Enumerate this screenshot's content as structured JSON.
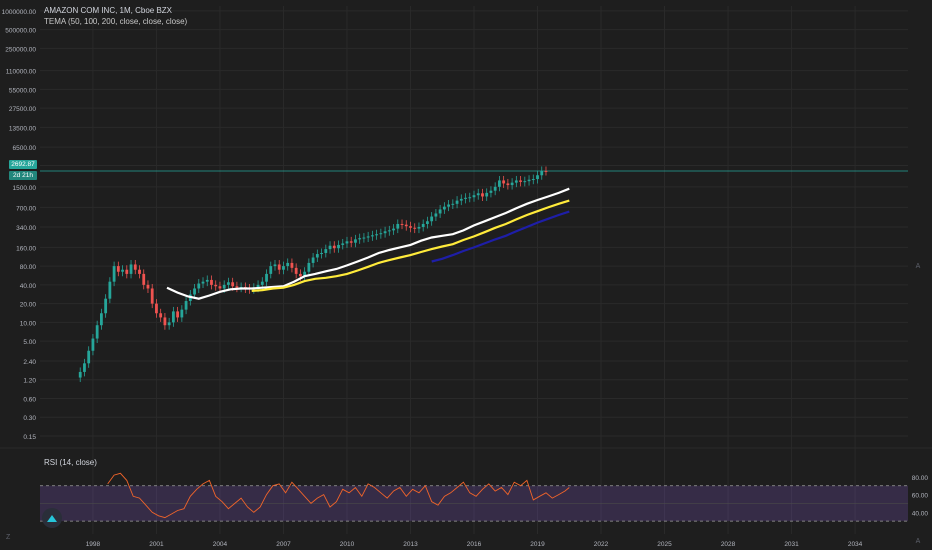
{
  "header": {
    "title": "AMAZON COM INC, 1M, Cboe BZX",
    "indicator": "TEMA (50, 100, 200, close, close, close)"
  },
  "rsi": {
    "label": "RSI (14, close)",
    "levels": [
      70,
      30
    ],
    "axis_labels": [
      "80.00",
      "60.00",
      "40.00"
    ]
  },
  "badges": {
    "last_price": "2692.87",
    "tema_value": "2d 21h"
  },
  "colors": {
    "bg": "#1e1e1e",
    "grid": "#2a2a2a",
    "up": "#26a69a",
    "down": "#ef5350",
    "tema50": "#ffffff",
    "tema100": "#ffeb3b",
    "tema200": "#1e1ea8",
    "rsi_line": "#f0642a",
    "rsi_band": "#7e57c2"
  },
  "chart_data": {
    "type": "line",
    "title": "AMAZON COM INC, 1M, Cboe BZX",
    "scale": "log",
    "price_ticks": [
      "1000000.00",
      "500000.00",
      "250000.00",
      "110000.00",
      "55000.00",
      "27500.00",
      "13500.00",
      "6500.00",
      "3300.00",
      "1500.00",
      "700.00",
      "340.00",
      "160.00",
      "80.00",
      "40.00",
      "20.00",
      "10.00",
      "5.00",
      "2.40",
      "1.20",
      "0.60",
      "0.30",
      "0.15"
    ],
    "price_ticks_values": [
      1000000,
      500000,
      250000,
      110000,
      55000,
      27500,
      13500,
      6500,
      3300,
      1500,
      700,
      340,
      160,
      80,
      40,
      20,
      10,
      5,
      2.4,
      1.2,
      0.6,
      0.3,
      0.15
    ],
    "x_ticks": [
      "1998",
      "2001",
      "2004",
      "2007",
      "2010",
      "2013",
      "2016",
      "2019",
      "2022",
      "2025",
      "2028",
      "2031",
      "2034"
    ],
    "x_ticks_values": [
      1998,
      2001,
      2004,
      2007,
      2010,
      2013,
      2016,
      2019,
      2022,
      2025,
      2028,
      2031,
      2034
    ],
    "xlim": [
      1995.5,
      2036.5
    ],
    "series": [
      {
        "name": "TEMA 50",
        "x": [
          2001.5,
          2002,
          2002.5,
          2003,
          2003.5,
          2004,
          2004.5,
          2005,
          2005.5,
          2006,
          2006.5,
          2007,
          2007.5,
          2008,
          2008.5,
          2009,
          2009.5,
          2010,
          2010.5,
          2011,
          2011.5,
          2012,
          2012.5,
          2013,
          2013.5,
          2014,
          2014.5,
          2015,
          2015.5,
          2016,
          2016.5,
          2017,
          2017.5,
          2018,
          2018.5,
          2019,
          2019.5,
          2020,
          2020.5
        ],
        "y": [
          36,
          30,
          26,
          24,
          27,
          31,
          34,
          35,
          35,
          36,
          37,
          38,
          45,
          55,
          60,
          66,
          72,
          82,
          95,
          110,
          130,
          145,
          160,
          175,
          205,
          230,
          245,
          260,
          300,
          360,
          420,
          490,
          570,
          680,
          800,
          920,
          1050,
          1200,
          1400
        ]
      },
      {
        "name": "TEMA 100",
        "x": [
          2005.5,
          2006,
          2006.5,
          2007,
          2007.5,
          2008,
          2008.5,
          2009,
          2009.5,
          2010,
          2010.5,
          2011,
          2011.5,
          2012,
          2012.5,
          2013,
          2013.5,
          2014,
          2014.5,
          2015,
          2015.5,
          2016,
          2016.5,
          2017,
          2017.5,
          2018,
          2018.5,
          2019,
          2019.5,
          2020,
          2020.5
        ],
        "y": [
          32,
          33,
          35,
          36,
          40,
          46,
          50,
          52,
          55,
          60,
          68,
          78,
          90,
          100,
          110,
          120,
          135,
          150,
          165,
          180,
          210,
          240,
          280,
          330,
          380,
          450,
          530,
          610,
          700,
          800,
          900
        ]
      },
      {
        "name": "TEMA 200",
        "x": [
          2014,
          2014.5,
          2015,
          2015.5,
          2016,
          2016.5,
          2017,
          2017.5,
          2018,
          2018.5,
          2019,
          2019.5,
          2020,
          2020.5
        ],
        "y": [
          95,
          105,
          120,
          140,
          160,
          185,
          215,
          245,
          290,
          340,
          400,
          460,
          530,
          600
        ]
      }
    ],
    "candles": {
      "x": [
        1997.4,
        1997.6,
        1997.8,
        1998.0,
        1998.2,
        1998.4,
        1998.6,
        1998.8,
        1999.0,
        1999.2,
        1999.4,
        1999.6,
        1999.8,
        2000.0,
        2000.2,
        2000.4,
        2000.6,
        2000.8,
        2001.0,
        2001.2,
        2001.4,
        2001.6,
        2001.8,
        2002.0,
        2002.2,
        2002.4,
        2002.6,
        2002.8,
        2003.0,
        2003.2,
        2003.4,
        2003.6,
        2003.8,
        2004.0,
        2004.2,
        2004.4,
        2004.6,
        2004.8,
        2005.0,
        2005.2,
        2005.4,
        2005.6,
        2005.8,
        2006.0,
        2006.2,
        2006.4,
        2006.6,
        2006.8,
        2007.0,
        2007.2,
        2007.4,
        2007.6,
        2007.8,
        2008.0,
        2008.2,
        2008.4,
        2008.6,
        2008.8,
        2009.0,
        2009.2,
        2009.4,
        2009.6,
        2009.8,
        2010.0,
        2010.2,
        2010.4,
        2010.6,
        2010.8,
        2011.0,
        2011.2,
        2011.4,
        2011.6,
        2011.8,
        2012.0,
        2012.2,
        2012.4,
        2012.6,
        2012.8,
        2013.0,
        2013.2,
        2013.4,
        2013.6,
        2013.8,
        2014.0,
        2014.2,
        2014.4,
        2014.6,
        2014.8,
        2015.0,
        2015.2,
        2015.4,
        2015.6,
        2015.8,
        2016.0,
        2016.2,
        2016.4,
        2016.6,
        2016.8,
        2017.0,
        2017.2,
        2017.4,
        2017.6,
        2017.8,
        2018.0,
        2018.2,
        2018.4,
        2018.6,
        2018.8,
        2019.0,
        2019.2,
        2019.4,
        2019.6,
        2019.8,
        2020.0,
        2020.2,
        2020.4
      ],
      "close": [
        1.6,
        2.2,
        3.5,
        5.5,
        9,
        14,
        24,
        45,
        80,
        65,
        70,
        60,
        85,
        70,
        60,
        40,
        35,
        20,
        14,
        12,
        9,
        10,
        15,
        12,
        16,
        22,
        28,
        35,
        42,
        45,
        48,
        40,
        38,
        35,
        40,
        44,
        38,
        36,
        37,
        35,
        34,
        36,
        40,
        45,
        60,
        80,
        85,
        70,
        80,
        90,
        75,
        60,
        55,
        65,
        90,
        110,
        125,
        130,
        150,
        170,
        155,
        175,
        185,
        200,
        190,
        215,
        225,
        230,
        240,
        250,
        260,
        270,
        290,
        300,
        320,
        380,
        370,
        350,
        330,
        320,
        340,
        380,
        420,
        500,
        560,
        650,
        720,
        780,
        800,
        900,
        960,
        1000,
        1020,
        1100,
        1180,
        1050,
        1200,
        1300,
        1500,
        1900,
        1700,
        1600,
        1750,
        1900,
        1800,
        1850,
        1950,
        2000,
        2300,
        2700,
        2692
      ],
      "open": [
        1.3,
        1.6,
        2.2,
        3.5,
        5.5,
        9,
        14,
        24,
        45,
        80,
        65,
        70,
        60,
        85,
        70,
        60,
        40,
        35,
        20,
        14,
        12,
        9,
        10,
        15,
        12,
        16,
        22,
        28,
        35,
        42,
        45,
        48,
        40,
        38,
        35,
        40,
        44,
        38,
        36,
        37,
        35,
        34,
        36,
        40,
        45,
        60,
        80,
        85,
        70,
        80,
        90,
        75,
        60,
        55,
        65,
        90,
        110,
        125,
        130,
        150,
        170,
        155,
        175,
        185,
        200,
        190,
        215,
        225,
        230,
        240,
        250,
        260,
        270,
        290,
        300,
        320,
        380,
        370,
        350,
        330,
        320,
        340,
        380,
        420,
        500,
        560,
        650,
        720,
        780,
        800,
        900,
        960,
        1000,
        1020,
        1100,
        1180,
        1050,
        1200,
        1300,
        1500,
        1900,
        1700,
        1600,
        1750,
        1900,
        1800,
        1850,
        1950,
        2000,
        2300,
        2700
      ]
    },
    "rsi": {
      "x": [
        1998.7,
        1999,
        1999.3,
        1999.6,
        1999.9,
        2000.2,
        2000.5,
        2000.8,
        2001.1,
        2001.4,
        2001.7,
        2002,
        2002.3,
        2002.6,
        2002.9,
        2003.2,
        2003.5,
        2003.8,
        2004.1,
        2004.4,
        2004.7,
        2005,
        2005.3,
        2005.6,
        2005.9,
        2006.2,
        2006.5,
        2006.8,
        2007.1,
        2007.4,
        2007.7,
        2008,
        2008.3,
        2008.6,
        2008.9,
        2009.2,
        2009.5,
        2009.8,
        2010.1,
        2010.4,
        2010.7,
        2011,
        2011.3,
        2011.6,
        2011.9,
        2012.2,
        2012.5,
        2012.8,
        2013.1,
        2013.4,
        2013.7,
        2014,
        2014.3,
        2014.6,
        2014.9,
        2015.2,
        2015.5,
        2015.8,
        2016.1,
        2016.4,
        2016.7,
        2017,
        2017.3,
        2017.6,
        2017.9,
        2018.2,
        2018.5,
        2018.8,
        2019.1,
        2019.4,
        2019.7,
        2020,
        2020.3,
        2020.5
      ],
      "y": [
        72,
        82,
        84,
        76,
        58,
        56,
        48,
        40,
        36,
        34,
        38,
        42,
        44,
        58,
        66,
        72,
        76,
        58,
        52,
        44,
        50,
        56,
        46,
        40,
        46,
        60,
        70,
        72,
        62,
        74,
        66,
        58,
        50,
        56,
        60,
        46,
        52,
        66,
        62,
        68,
        58,
        72,
        68,
        62,
        56,
        64,
        68,
        58,
        66,
        62,
        70,
        52,
        48,
        58,
        62,
        68,
        74,
        62,
        58,
        66,
        72,
        64,
        68,
        60,
        74,
        70,
        76,
        54,
        58,
        62,
        56,
        60,
        64,
        68
      ]
    }
  }
}
